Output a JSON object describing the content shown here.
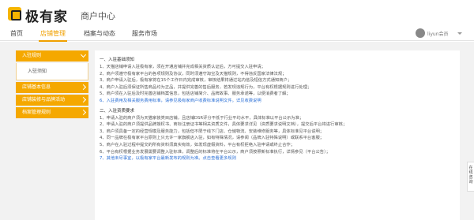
{
  "brand": {
    "name": "极有家",
    "subtitle": "商户中心"
  },
  "nav": [
    {
      "label": "首页",
      "active": false
    },
    {
      "label": "店铺管理",
      "active": true
    },
    {
      "label": "档案与动态",
      "active": false
    },
    {
      "label": "服务市场",
      "active": false
    }
  ],
  "user": {
    "name": "liyun会员"
  },
  "sidebar": {
    "items": [
      {
        "label": "入驻规则",
        "open": true,
        "sub": "入驻须知"
      },
      {
        "label": "店铺基本信息",
        "open": false
      },
      {
        "label": "店铺装修与品牌活动",
        "open": false
      },
      {
        "label": "档案管理规则",
        "open": false
      }
    ]
  },
  "content": {
    "section1_title": "一、入驻基础须知",
    "section1_lines": [
      "1、天猫店铺申请入驻极有家，须在开通店铺并完成相关资质认证后，方可提交入驻申请；",
      "2、商户须遵守极有家平台的各项规则及协议，同时须遵守淘宝及天猫规则，不得违反国家法律法规；",
      "3、商户申请入驻后，极有家将在15个工作日内完成审核，审核结果将通过站内信及短信方式通知商户；",
      "4、商户入驻后须保证所售商品均为正品，并提供完善的售后服务，若发现违规行为，平台有权根据规则进行处理；",
      "5、商户须在入驻后及时完善店铺档案信息，包括店铺简介、品牌故事、服务承诺等，以便消费者了解；",
      "6、入驻费用及相关服务费用标准，请参见极有家商户收费标准说明文件。详见收费说明"
    ],
    "section2_title": "二、入驻资质要求",
    "section2_lines": [
      "1、申请入驻的商户须为天猫家装类目店铺，且店铺DSR评分不低于行业平均水平，具体标准以平台公示为准；",
      "2、申请入驻的商户须提供品牌授权书、商标注册证书等相关资质文件，具体要求详见（资质要求说明文档），提交后平台将进行审核；",
      "3、商户须具备一定的经营规模及服务能力，包括但不限于线下门店、仓储物流、安装维修服务等，具体标准见平台说明；",
      "4、同一品牌在极有家平台原则上只允许一家旗舰店入驻，如有特殊情况，请参阅（品牌入驻特殊说明）或联系平台客服；",
      "5、商户在入驻过程中提交的所有资料须真实有效，如发现虚假资料，平台有权拒绝入驻申请或终止合作；",
      "6、平台有权根据业务发展需要调整入驻标准，调整后的标准将在平台公示，商户须按照新标准执行，详情参见（平台公告）；",
      "7、其他未尽事宜，以极有家平台最新发布的规则为准。点击查看更多规则"
    ]
  },
  "side_tab": {
    "label": "在线咨询"
  }
}
